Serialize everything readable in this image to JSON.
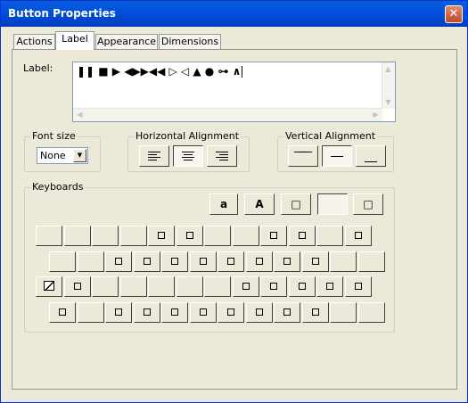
{
  "window": {
    "title": "Button Properties",
    "close_glyph": "✕"
  },
  "tabs": [
    {
      "label": "Actions",
      "active": false
    },
    {
      "label": "Label",
      "active": true
    },
    {
      "label": "Appearance",
      "active": false
    },
    {
      "label": "Dimensions",
      "active": false
    }
  ],
  "label_section": {
    "caption": "Label:",
    "value": "❚❚ ■ ▶ ◀▶▶◀◀ ▷ ◁ ▲ ● ⊶ ∧"
  },
  "font_size": {
    "caption": "Font size",
    "selected": "None"
  },
  "horizontal_alignment": {
    "caption": "Horizontal Alignment",
    "options": [
      "left-align-icon",
      "center-align-icon",
      "right-align-icon"
    ],
    "selected_index": 1
  },
  "vertical_alignment": {
    "caption": "Vertical Alignment",
    "options": [
      "top-align-icon",
      "middle-align-icon",
      "bottom-align-icon"
    ],
    "selected_index": 1
  },
  "keyboards": {
    "caption": "Keyboards",
    "top_keys": [
      "a",
      "A",
      "□",
      "",
      "□"
    ],
    "row1": [
      "",
      "",
      "",
      "",
      "□",
      "□",
      "",
      "",
      "□",
      "□",
      "",
      "□"
    ],
    "row2": [
      "",
      "",
      "□",
      "□",
      "□",
      "□",
      "□",
      "□",
      "□",
      "□",
      "",
      ""
    ],
    "row3": [
      "◘",
      "□",
      "",
      "",
      "",
      "",
      "",
      "□",
      "□",
      "□",
      "□",
      "□"
    ],
    "row4": [
      "□",
      "",
      "□",
      "□",
      "□",
      "□",
      "□",
      "□",
      "□",
      "□",
      "",
      ""
    ]
  },
  "colors": {
    "titlebar": "#0050e0",
    "face": "#ece9d8",
    "close": "#c4472a"
  }
}
